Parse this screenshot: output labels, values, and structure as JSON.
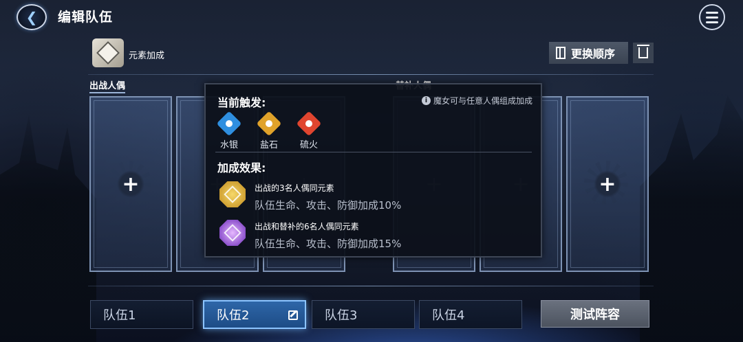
{
  "header": {
    "title": "编辑队伍"
  },
  "element_bonus": {
    "label": "元素加成"
  },
  "toolbar": {
    "reorder_label": "更换顺序"
  },
  "sections": {
    "active_label": "出战人偶",
    "substitute_label": "替补人偶"
  },
  "popup": {
    "title": "当前触发:",
    "hint": "魔女可与任意人偶组成加成",
    "elements": [
      {
        "name": "水银",
        "icon": "mercury-icon",
        "color": "#2f8fe0"
      },
      {
        "name": "盐石",
        "icon": "salt-icon",
        "color": "#e0a22a"
      },
      {
        "name": "硫火",
        "icon": "sulfur-icon",
        "color": "#e0452f"
      }
    ],
    "effect_title": "加成效果:",
    "effects": [
      {
        "condition": "出战的3名人偶同元素",
        "description": "队伍生命、攻击、防御加成10%",
        "color": "#e2b23a"
      },
      {
        "condition": "出战和替补的6名人偶同元素",
        "description": "队伍生命、攻击、防御加成15%",
        "color": "#9a58d8"
      }
    ]
  },
  "teams": [
    {
      "label": "队伍1",
      "active": false
    },
    {
      "label": "队伍2",
      "active": true
    },
    {
      "label": "队伍3",
      "active": false
    },
    {
      "label": "队伍4",
      "active": false
    }
  ],
  "test_button_label": "测试阵容"
}
